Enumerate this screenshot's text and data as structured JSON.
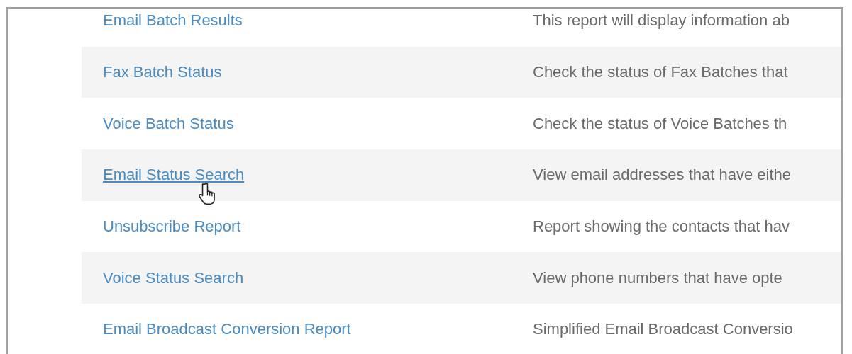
{
  "reports": [
    {
      "name": "Email Batch Results",
      "description": "This report will display information ab",
      "hovered": false
    },
    {
      "name": "Fax Batch Status",
      "description": "Check the status of Fax Batches that",
      "hovered": false
    },
    {
      "name": "Voice Batch Status",
      "description": "Check the status of Voice Batches th",
      "hovered": false
    },
    {
      "name": "Email Status Search",
      "description": "View email addresses that have eithe",
      "hovered": true
    },
    {
      "name": "Unsubscribe Report",
      "description": "Report showing the contacts that hav",
      "hovered": false
    },
    {
      "name": "Voice Status Search",
      "description": "View phone numbers that have opte",
      "hovered": false
    },
    {
      "name": "Email Broadcast Conversion Report",
      "description": "Simplified Email Broadcast Conversio",
      "hovered": false
    }
  ]
}
